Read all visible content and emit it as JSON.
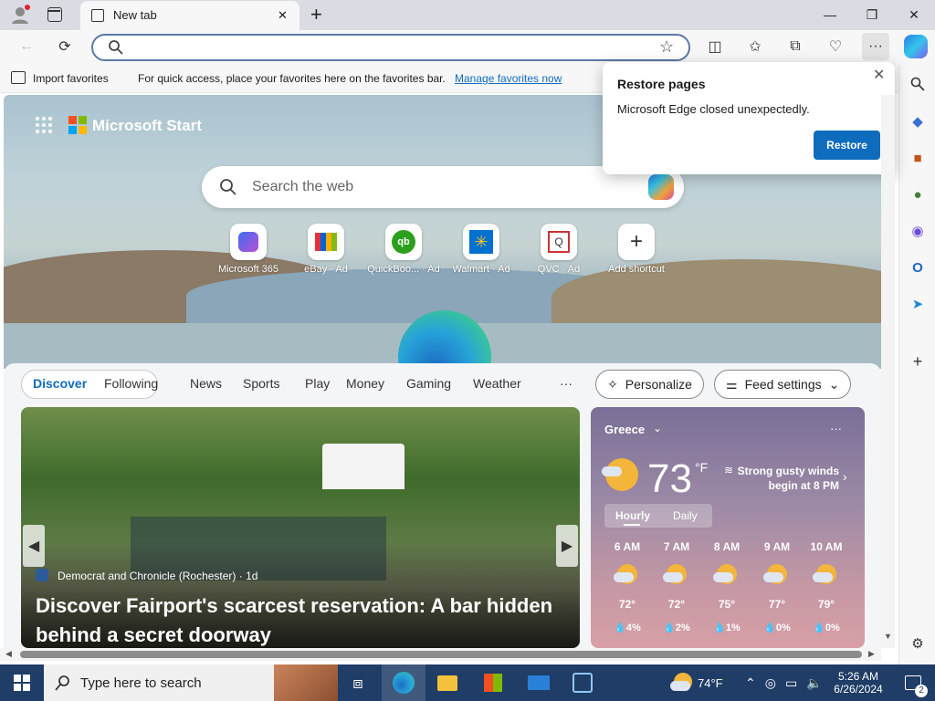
{
  "browser": {
    "tab_title": "New tab",
    "new_tab_symbol": "+",
    "window_controls": {
      "minimize": "—",
      "restore": "❐",
      "close": "✕"
    },
    "tab_close": "✕",
    "address_value": ""
  },
  "favorites_bar": {
    "import_label": "Import favorites",
    "hint_text": "For quick access, place your favorites here on the favorites bar.",
    "manage_link": "Manage favorites now"
  },
  "popup": {
    "title": "Restore pages",
    "message": "Microsoft Edge closed unexpectedly.",
    "button": "Restore"
  },
  "start": {
    "brand": "Microsoft Start",
    "search_placeholder": "Search the web",
    "quick_links": [
      {
        "label": "Microsoft 365",
        "icon": "microsoft-365-icon"
      },
      {
        "label": "eBay · Ad",
        "icon": "ebay-icon"
      },
      {
        "label": "QuickBoo... · Ad",
        "icon": "quickbooks-icon"
      },
      {
        "label": "Walmart · Ad",
        "icon": "walmart-icon"
      },
      {
        "label": "QVC · Ad",
        "icon": "qvc-icon"
      },
      {
        "label": "Add shortcut",
        "icon": "plus-icon"
      }
    ]
  },
  "feed": {
    "tabs": [
      "Discover",
      "Following",
      "News",
      "Sports",
      "Play",
      "Money",
      "Gaming",
      "Weather"
    ],
    "more": "···",
    "personalize": "Personalize",
    "feed_settings": "Feed settings"
  },
  "news": {
    "source": "Democrat and Chronicle (Rochester) · 1d",
    "headline": "Discover Fairport's scarcest reservation: A bar hidden behind a secret doorway"
  },
  "weather": {
    "location": "Greece",
    "more": "···",
    "temp": "73",
    "unit": "°F",
    "alert": "Strong gusty winds begin at 8 PM",
    "tab_hourly": "Hourly",
    "tab_daily": "Daily",
    "hours": [
      {
        "time": "6 AM",
        "temp": "72°",
        "precip": "4%"
      },
      {
        "time": "7 AM",
        "temp": "72°",
        "precip": "2%"
      },
      {
        "time": "8 AM",
        "temp": "75°",
        "precip": "1%"
      },
      {
        "time": "9 AM",
        "temp": "77°",
        "precip": "0%"
      },
      {
        "time": "10 AM",
        "temp": "79°",
        "precip": "0%"
      }
    ]
  },
  "taskbar": {
    "search_placeholder": "Type here to search",
    "weather_temp": "74°F",
    "time": "5:26 AM",
    "date": "6/26/2024",
    "notification_count": "2"
  },
  "colors": {
    "accent": "#0f6cbd",
    "taskbar": "#1f3d66",
    "link": "#0f6cbd"
  }
}
